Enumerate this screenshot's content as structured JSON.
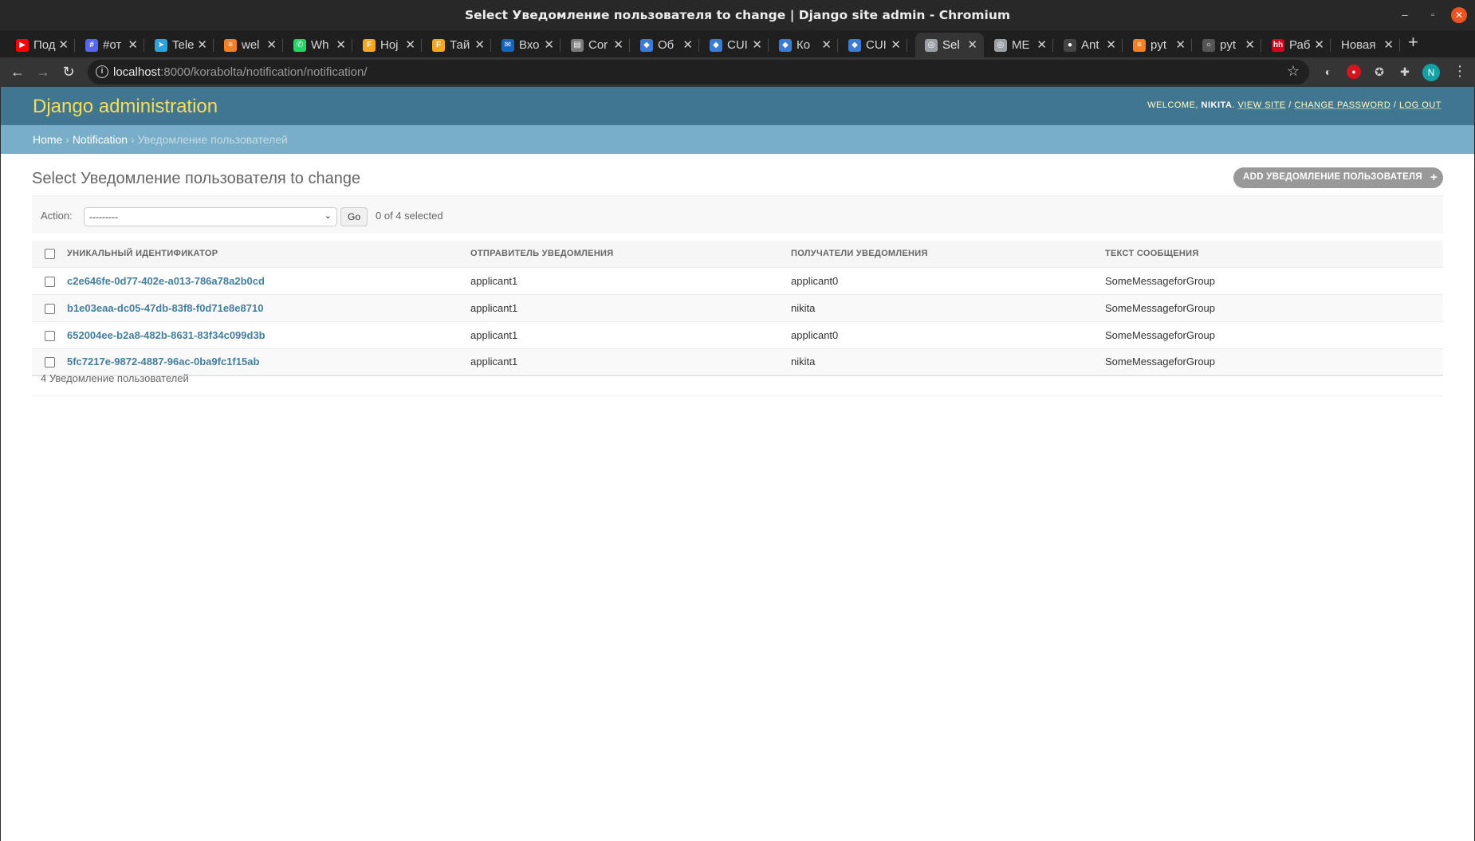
{
  "window": {
    "title": "Select Уведомление пользователя to change | Django site admin - Chromium",
    "min_glyph": "–",
    "max_glyph": "▫",
    "close_glyph": "✕"
  },
  "tabs": [
    {
      "label": "Под",
      "icon": "youtube-icon",
      "color": "#ff0000",
      "glyph": "▶"
    },
    {
      "label": "#от",
      "icon": "chat-icon",
      "color": "#5865f2",
      "glyph": "#"
    },
    {
      "label": "Tele",
      "icon": "telegram-icon",
      "color": "#2aa3df",
      "glyph": "➤"
    },
    {
      "label": "wel",
      "icon": "stackoverflow-icon",
      "color": "#f48024",
      "glyph": "≡"
    },
    {
      "label": "Wh",
      "icon": "whatsapp-icon",
      "color": "#25d366",
      "glyph": "✆"
    },
    {
      "label": "Ној",
      "icon": "fs-icon",
      "color": "#f5a623",
      "glyph": "F"
    },
    {
      "label": "Тай",
      "icon": "fs-icon",
      "color": "#f5a623",
      "glyph": "F"
    },
    {
      "label": "Вхо",
      "icon": "mail-icon",
      "color": "#1565c0",
      "glyph": "✉"
    },
    {
      "label": "Cor",
      "icon": "doc-icon",
      "color": "#7a7a7a",
      "glyph": "▤"
    },
    {
      "label": "Об",
      "icon": "cube-icon",
      "color": "#3b7bd4",
      "glyph": "◆"
    },
    {
      "label": "CUI",
      "icon": "cube-icon",
      "color": "#3b7bd4",
      "glyph": "◆"
    },
    {
      "label": "Ко",
      "icon": "cube-icon",
      "color": "#3b7bd4",
      "glyph": "◆"
    },
    {
      "label": "CUI",
      "icon": "cube-icon",
      "color": "#3b7bd4",
      "glyph": "◆"
    },
    {
      "label": "Sel",
      "icon": "globe-icon",
      "color": "#9aa0a6",
      "glyph": "◎",
      "active": true
    },
    {
      "label": "ME",
      "icon": "globe-icon",
      "color": "#9aa0a6",
      "glyph": "◎"
    },
    {
      "label": "Ant",
      "icon": "github-icon",
      "color": "#444444",
      "glyph": "●"
    },
    {
      "label": "pyt",
      "icon": "stackoverflow-icon",
      "color": "#f48024",
      "glyph": "≡"
    },
    {
      "label": "pyt",
      "icon": "search-icon",
      "color": "#555555",
      "glyph": "○"
    },
    {
      "label": "Раб",
      "icon": "hh-icon",
      "color": "#d6001c",
      "glyph": "hh"
    },
    {
      "label": "Новая"
    }
  ],
  "toolbar": {
    "url_host": "localhost",
    "url_path": ":8000/korabolta/notification/notification/",
    "profile_initial": "N",
    "back_glyph": "←",
    "forward_glyph": "→",
    "reload_glyph": "↻",
    "star_glyph": "☆",
    "newtab_glyph": "+",
    "menu_glyph": "⋮"
  },
  "admin": {
    "branding": "Django administration",
    "welcome": "WELCOME,",
    "username": "NIKITA",
    "view_site": "VIEW SITE",
    "change_password": "CHANGE PASSWORD",
    "log_out": "LOG OUT",
    "slash": " / "
  },
  "breadcrumbs": {
    "home": "Home",
    "app": "Notification",
    "current": "Уведомление пользователей",
    "sep": " › "
  },
  "main": {
    "title": "Select Уведомление пользователя to change",
    "add_button": "ADD УВЕДОМЛЕНИЕ ПОЛЬЗОВАТЕЛЯ",
    "add_glyph": "+"
  },
  "actions": {
    "label": "Action:",
    "selected": "---------",
    "go": "Go",
    "counter": "0 of 4 selected"
  },
  "table": {
    "headers": [
      "УНИКАЛЬНЫЙ ИДЕНТИФИКАТОР",
      "ОТПРАВИТЕЛЬ УВЕДОМЛЕНИЯ",
      "ПОЛУЧАТЕЛИ УВЕДОМЛЕНИЯ",
      "ТЕКСТ СООБЩЕНИЯ"
    ],
    "rows": [
      {
        "id": "c2e646fe-0d77-402e-a013-786a78a2b0cd",
        "sender": "applicant1",
        "recipients": "applicant0",
        "text": "SomeMessageforGroup"
      },
      {
        "id": "b1e03eaa-dc05-47db-83f8-f0d71e8e8710",
        "sender": "applicant1",
        "recipients": "nikita",
        "text": "SomeMessageforGroup"
      },
      {
        "id": "652004ee-b2a8-482b-8631-83f34c099d3b",
        "sender": "applicant1",
        "recipients": "applicant0",
        "text": "SomeMessageforGroup"
      },
      {
        "id": "5fc7217e-9872-4887-96ac-0ba9fc1f15ab",
        "sender": "applicant1",
        "recipients": "nikita",
        "text": "SomeMessageforGroup"
      }
    ]
  },
  "paginator": "4 Уведомление пользователей"
}
